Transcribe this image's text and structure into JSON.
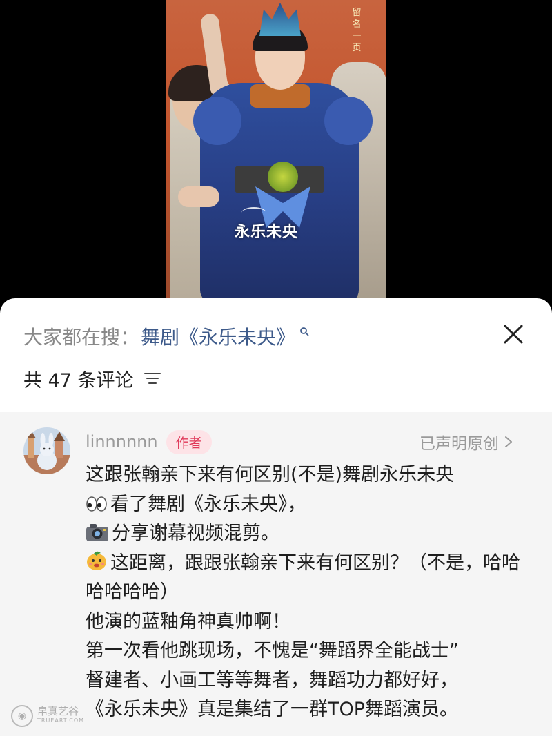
{
  "video": {
    "side_text": "留名一页",
    "overlay_title": "永乐未央"
  },
  "search_bar": {
    "prefix": "大家都在搜：",
    "query": "舞剧《永乐未央》"
  },
  "comments_header": {
    "count_text": "共 47 条评论"
  },
  "comment": {
    "author": "linnnnnn",
    "author_badge": "作者",
    "original_claim": "已声明原创",
    "lines": [
      "这跟张翰亲下来有何区别(不是)舞剧永乐未央",
      "看了舞剧《永乐未央》，",
      "分享谢幕视频混剪。",
      "这距离，跟跟张翰亲下来有何区别？（不是，哈哈哈哈哈哈）",
      "他演的蓝釉角神真帅啊！",
      "第一次看他跳现场，不愧是“舞蹈界全能战士”",
      "督建者、小画工等等舞者，舞蹈功力都好好，",
      "《永乐未央》真是集结了一群TOP舞蹈演员。"
    ],
    "emojis": [
      "eyes",
      "camera",
      "mango-face"
    ]
  },
  "watermark": {
    "cn": "帛真艺谷",
    "en": "TRUEART.COM"
  },
  "colors": {
    "query_link": "#3d5a8a",
    "badge_bg": "#fde3e7",
    "badge_text": "#e0395a",
    "comment_bg": "#f5f5f5"
  }
}
